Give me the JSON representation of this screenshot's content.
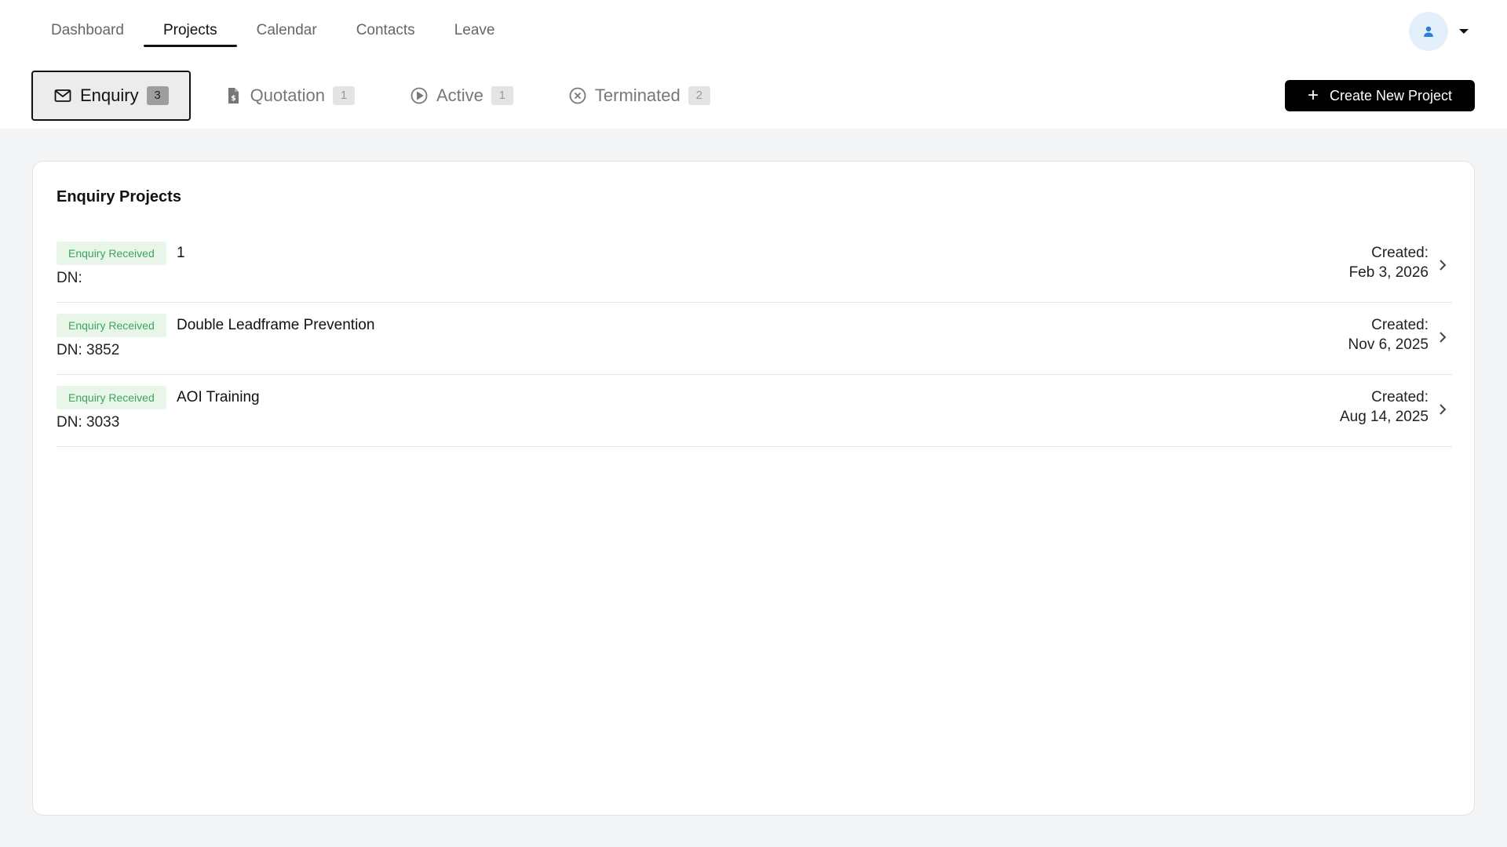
{
  "nav": {
    "items": [
      {
        "label": "Dashboard"
      },
      {
        "label": "Projects"
      },
      {
        "label": "Calendar"
      },
      {
        "label": "Contacts"
      },
      {
        "label": "Leave"
      }
    ],
    "active": "Projects"
  },
  "status_tabs": [
    {
      "label": "Enquiry",
      "count": "3",
      "icon": "mail-icon"
    },
    {
      "label": "Quotation",
      "count": "1",
      "icon": "document-dollar-icon"
    },
    {
      "label": "Active",
      "count": "1",
      "icon": "play-circle-icon"
    },
    {
      "label": "Terminated",
      "count": "2",
      "icon": "x-circle-icon"
    }
  ],
  "create_button": {
    "label": "Create New Project"
  },
  "card": {
    "title": "Enquiry Projects"
  },
  "projects": [
    {
      "status": "Enquiry Received",
      "name": "1",
      "dn": "DN:",
      "created_label": "Created:",
      "created_date": "Feb 3, 2026"
    },
    {
      "status": "Enquiry Received",
      "name": "Double Leadframe Prevention",
      "dn": "DN: 3852",
      "created_label": "Created:",
      "created_date": "Nov 6, 2025"
    },
    {
      "status": "Enquiry Received",
      "name": "AOI Training",
      "dn": "DN: 3033",
      "created_label": "Created:",
      "created_date": "Aug 14, 2025"
    }
  ],
  "colors": {
    "accent": "#000000",
    "badge_bg": "#e8f6ea",
    "badge_text": "#3fa35a",
    "avatar_bg": "#e3f0fb",
    "avatar_icon": "#2a7fd4"
  }
}
